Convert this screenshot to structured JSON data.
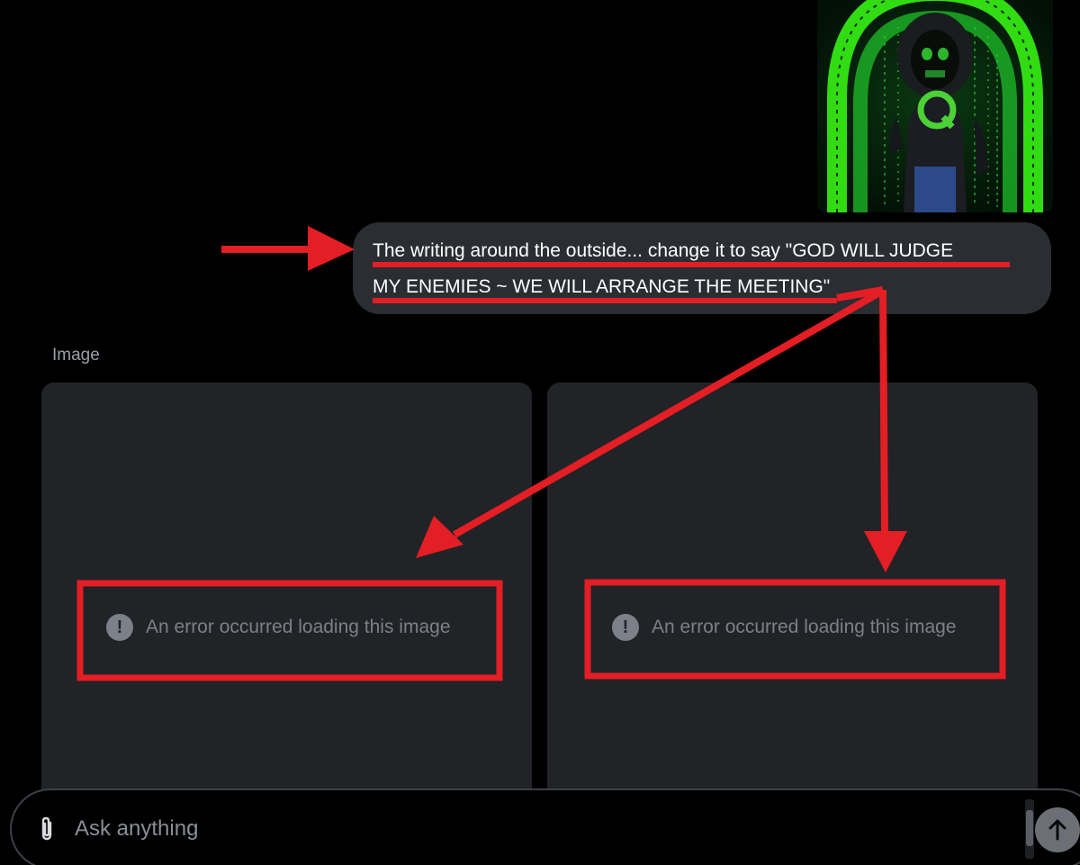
{
  "attachment": {
    "image_letter": "Q",
    "image_text": "NEONEENENEENE"
  },
  "message": {
    "line1": "The writing around the outside... change it to say \"GOD WILL JUDGE",
    "line2": "MY ENEMIES ~ WE WILL ARRANGE THE MEETING\""
  },
  "results": {
    "label": "Image",
    "cards": [
      {
        "error_text": "An error occurred loading this image"
      },
      {
        "error_text": "An error occurred loading this image"
      }
    ]
  },
  "composer": {
    "placeholder": "Ask anything",
    "value": ""
  },
  "colors": {
    "annotation_red": "#e31e24",
    "bubble_bg": "#2a2d32",
    "card_bg": "#212327",
    "neon_green": "#39ff14"
  },
  "icons": {
    "error": "exclamation-circle-icon",
    "attach": "paperclip-icon",
    "send": "arrow-up-icon"
  }
}
